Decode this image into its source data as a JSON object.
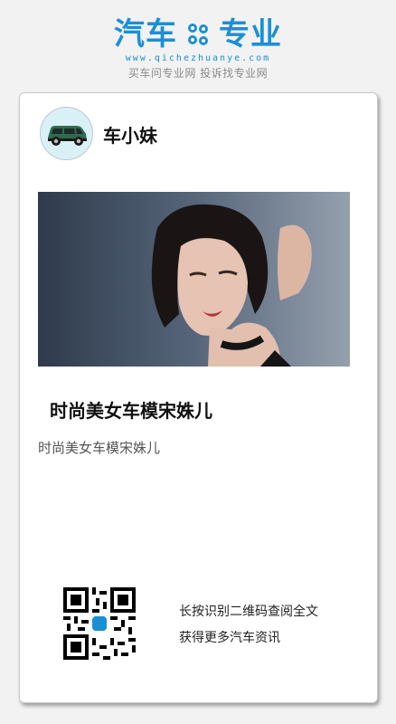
{
  "brand": {
    "logo_left": "汽车",
    "logo_right": "专业",
    "url": "www.qichezhuanye.com",
    "slogan": "买车问专业网 投诉找专业网",
    "color": "#1b8fd6"
  },
  "author": {
    "name": "车小妹",
    "avatar_icon": "car-icon"
  },
  "article": {
    "image_icon": "photo-of-woman",
    "title": "时尚美女车模宋姝儿",
    "summary": "时尚美女车模宋姝儿"
  },
  "footer": {
    "qr_icon": "qr-code-icon",
    "line1": "长按识别二维码查阅全文",
    "line2": "获得更多汽车资讯"
  }
}
